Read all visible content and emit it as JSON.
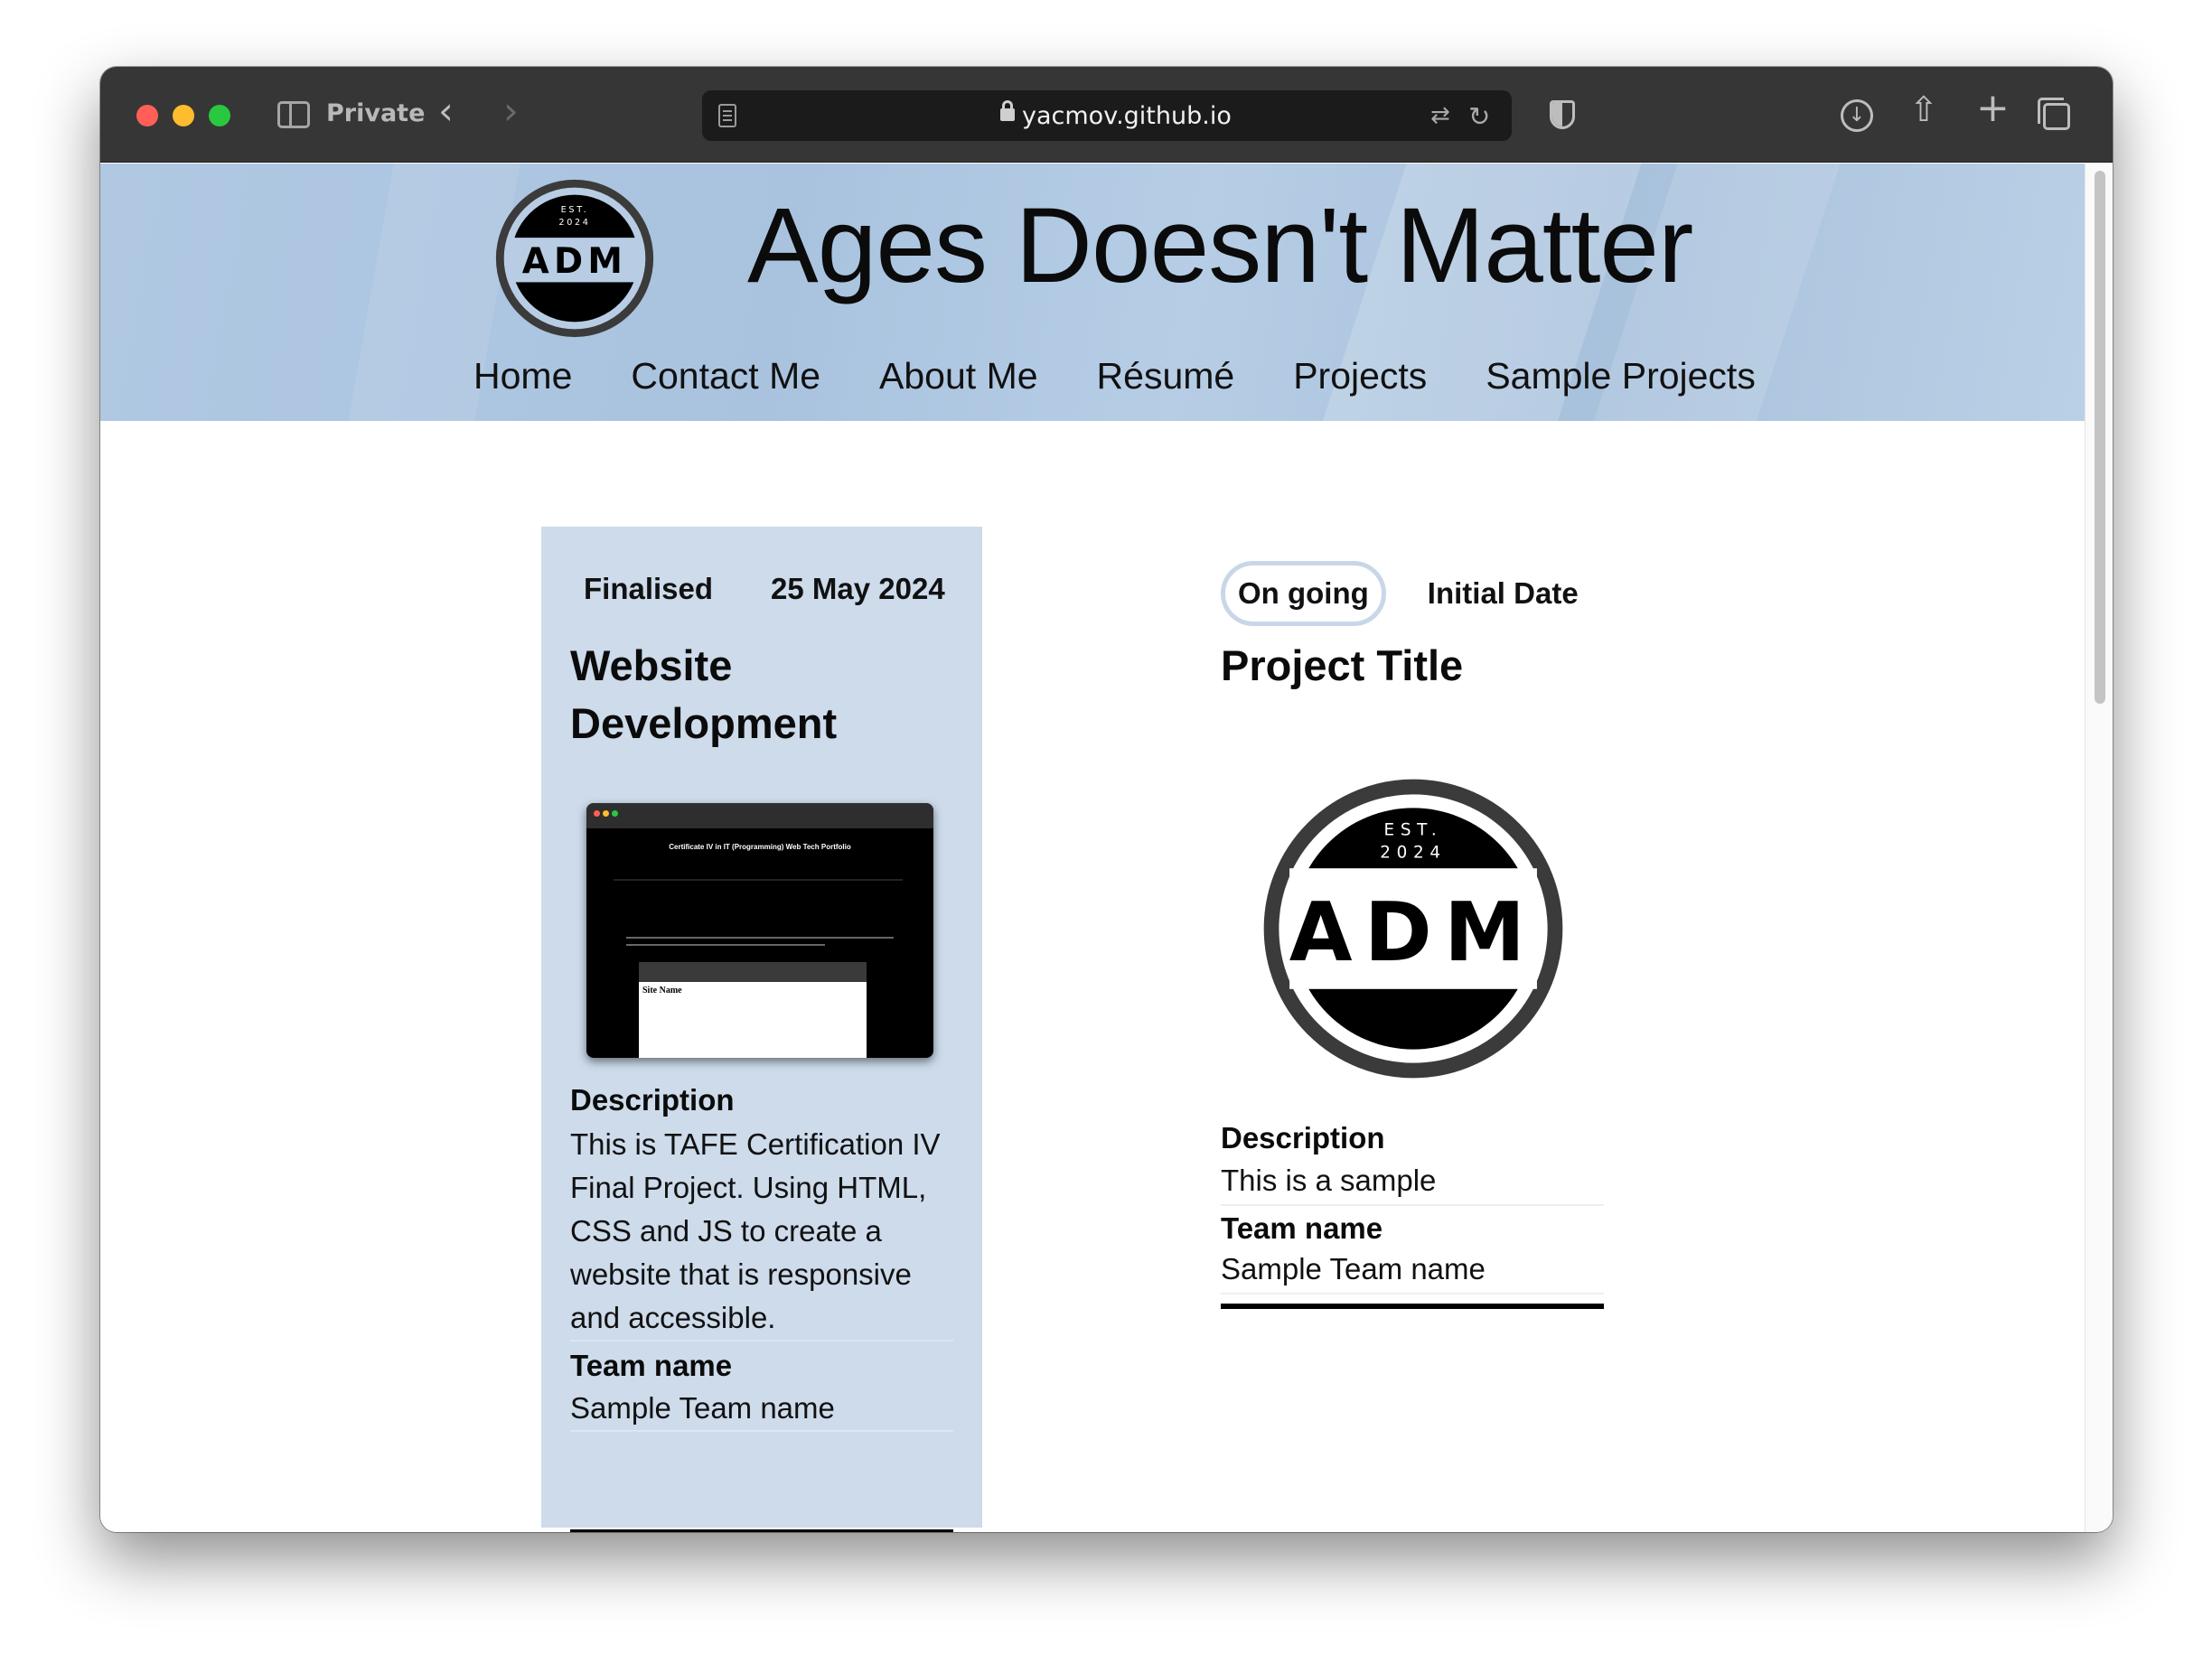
{
  "browser": {
    "mode_label": "Private",
    "url": "yacmov.github.io"
  },
  "site": {
    "title": "Ages Doesn't Matter",
    "logo": {
      "est": "EST.",
      "year": "2024",
      "letters": "ADM"
    },
    "nav": [
      "Home",
      "Contact Me",
      "About Me",
      "Résumé",
      "Projects",
      "Sample Projects"
    ]
  },
  "projects": [
    {
      "status": "Finalised",
      "date": "25 May 2024",
      "title": "Website Development",
      "thumbnail": {
        "page_heading": "Certificate IV in IT (Programming) Web Tech Portfolio",
        "inner_site_name": "Site Name"
      },
      "description_label": "Description",
      "description": "This is TAFE Certification IV Final Project. Using HTML, CSS and JS to create a website that is responsive and accessible.",
      "team_label": "Team name",
      "team": "Sample Team name"
    },
    {
      "status": "On going",
      "date": "Initial Date",
      "title": "Project Title",
      "description_label": "Description",
      "description": "This is a sample",
      "team_label": "Team name",
      "team": "Sample Team name"
    }
  ],
  "colors": {
    "header_bg": "#aec6e0",
    "card_bg": "#cddbeb",
    "toolbar_bg": "#363636"
  }
}
